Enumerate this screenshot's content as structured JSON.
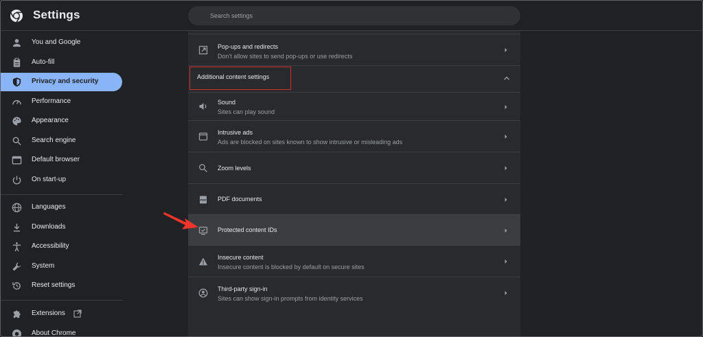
{
  "header": {
    "title": "Settings",
    "search_placeholder": "Search settings"
  },
  "sidebar": {
    "items": [
      {
        "label": "You and Google",
        "icon": "person-icon"
      },
      {
        "label": "Auto-fill",
        "icon": "clipboard-icon"
      },
      {
        "label": "Privacy and security",
        "icon": "shield-icon",
        "active": true
      },
      {
        "label": "Performance",
        "icon": "speedometer-icon"
      },
      {
        "label": "Appearance",
        "icon": "palette-icon"
      },
      {
        "label": "Search engine",
        "icon": "search-icon"
      },
      {
        "label": "Default browser",
        "icon": "browser-icon"
      },
      {
        "label": "On start-up",
        "icon": "power-icon"
      },
      {
        "label": "Languages",
        "icon": "globe-icon"
      },
      {
        "label": "Downloads",
        "icon": "download-icon"
      },
      {
        "label": "Accessibility",
        "icon": "accessibility-icon"
      },
      {
        "label": "System",
        "icon": "wrench-icon"
      },
      {
        "label": "Reset settings",
        "icon": "reset-icon"
      },
      {
        "label": "Extensions",
        "icon": "puzzle-icon"
      },
      {
        "label": "About Chrome",
        "icon": "chrome-icon"
      }
    ]
  },
  "content": {
    "popups": {
      "title": "Pop-ups and redirects",
      "subtitle": "Don't allow sites to send pop-ups or use redirects"
    },
    "section_title": "Additional content settings",
    "rows": [
      {
        "title": "Sound",
        "subtitle": "Sites can play sound",
        "icon": "speaker-icon"
      },
      {
        "title": "Intrusive ads",
        "subtitle": "Ads are blocked on sites known to show intrusive or misleading ads",
        "icon": "window-icon"
      },
      {
        "title": "Zoom levels",
        "subtitle": "",
        "icon": "zoom-icon"
      },
      {
        "title": "PDF documents",
        "subtitle": "",
        "icon": "pdf-icon"
      },
      {
        "title": "Protected content IDs",
        "subtitle": "",
        "icon": "protected-content-icon"
      },
      {
        "title": "Insecure content",
        "subtitle": "Insecure content is blocked by default on secure sites",
        "icon": "warning-icon"
      },
      {
        "title": "Third-party sign-in",
        "subtitle": "Sites can show sign-in prompts from identity services",
        "icon": "account-icon"
      }
    ]
  },
  "colors": {
    "background": "#202124",
    "card": "#292a2d",
    "accent": "#8ab4f8",
    "highlight_box": "#d93025",
    "arrow": "#f2352b"
  }
}
